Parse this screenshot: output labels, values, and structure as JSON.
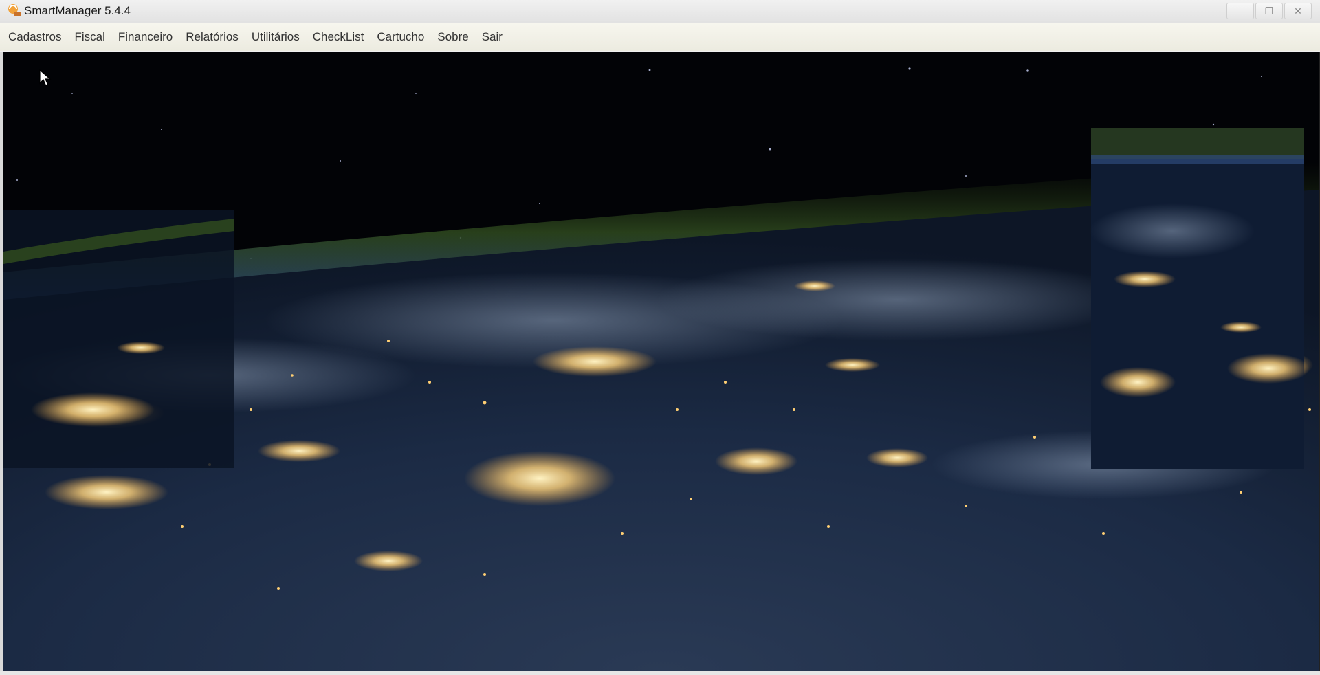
{
  "window": {
    "title": "SmartManager 5.4.4",
    "icon": "smartmanager-app-icon",
    "controls": {
      "minimize": "–",
      "maximize": "❐",
      "close": "✕"
    }
  },
  "menu": {
    "items": [
      {
        "id": "cadastros",
        "label": "Cadastros"
      },
      {
        "id": "fiscal",
        "label": "Fiscal"
      },
      {
        "id": "financeiro",
        "label": "Financeiro"
      },
      {
        "id": "relatorios",
        "label": "Relatórios"
      },
      {
        "id": "utilitarios",
        "label": "Utilitários"
      },
      {
        "id": "checklist",
        "label": "CheckList"
      },
      {
        "id": "cartucho",
        "label": "Cartucho"
      },
      {
        "id": "sobre",
        "label": "Sobre"
      },
      {
        "id": "sair",
        "label": "Sair"
      }
    ]
  },
  "background": {
    "description_icon": "earth-night-wallpaper",
    "colors": {
      "space": "#020306",
      "atmosphere": "#2f4a1f",
      "ocean": "#1b2a44",
      "city_lights": "#ffd27a"
    }
  },
  "pointer": "arrow-cursor-icon"
}
